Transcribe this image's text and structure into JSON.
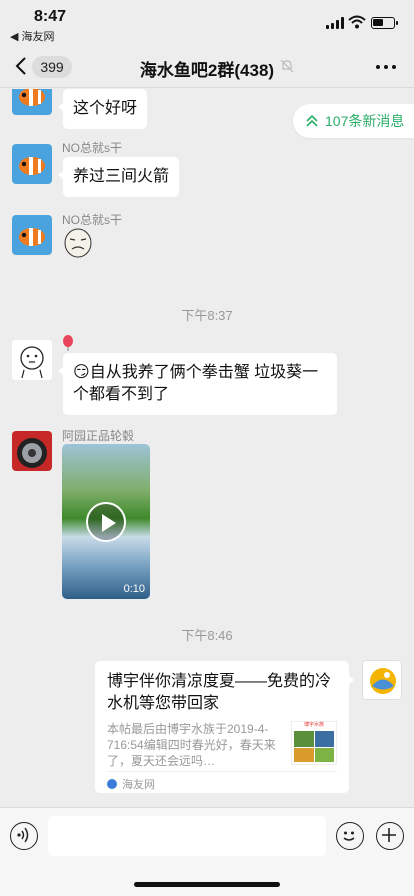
{
  "status": {
    "time": "8:47",
    "back_app": "◀ 海友网",
    "battery_level": 0.5
  },
  "nav": {
    "unread_count": "399",
    "title": "海水鱼吧2群(438)"
  },
  "new_messages": "107条新消息",
  "messages": [
    {
      "text": "这个好呀"
    },
    {
      "nick": "NO总就s干",
      "text": "养过三间火箭"
    },
    {
      "nick": "NO总就s干",
      "sticker": "doge-face-sticker"
    },
    {
      "timestamp": "下午8:37"
    },
    {
      "emoji": "😏",
      "text": "自从我养了俩个拳击蟹 垃圾葵一个都看不到了"
    },
    {
      "nick": "阿园正品轮毂",
      "video_duration": "0:10"
    },
    {
      "timestamp": "下午8:46"
    },
    {
      "card_title": "博宇伴你清凉度夏——免费的冷水机等您带回家",
      "card_desc": "本帖最后由博宇水族于2019-4-716:54编辑四时春光好，春天来了，夏天还会远吗…",
      "card_thumb_text": "博宇水族",
      "card_source": "海友网"
    }
  ],
  "colors": {
    "accent_green": "#2aae67",
    "background": "#ededed",
    "bubble": "#ffffff"
  }
}
